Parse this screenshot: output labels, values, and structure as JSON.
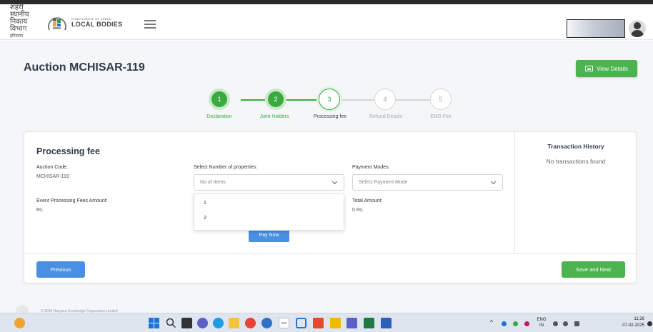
{
  "header": {
    "logo_hindi_main": "शहरी स्थानीय",
    "logo_hindi_sub": "निकाय विभाग",
    "logo_hindi_tiny": "हरियाणा",
    "logo_eng_top": "DIRECTORATE OF URBAN",
    "logo_eng_main": "LOCAL BODIES"
  },
  "page": {
    "title": "Auction MCHISAR-119",
    "view_details": "View Details"
  },
  "stepper": {
    "steps": [
      {
        "number": "1",
        "label": "Declaration",
        "state": "done"
      },
      {
        "number": "2",
        "label": "Joint Holders",
        "state": "done"
      },
      {
        "number": "3",
        "label": "Processing fee",
        "state": "active"
      },
      {
        "number": "4",
        "label": "Refund Details",
        "state": "todo"
      },
      {
        "number": "5",
        "label": "EMD Fee",
        "state": "todo"
      }
    ]
  },
  "form": {
    "section_title": "Processing fee",
    "auction_code_label": "Auction Code:",
    "auction_code_value": "MCHISAR-119",
    "properties_label": "Select Number of properties:",
    "properties_placeholder": "No of Items",
    "payment_label": "Payment Modes:",
    "payment_placeholder": "Select Payment Mode",
    "event_fee_label": "Event Processing Fees Amount:",
    "event_fee_value": "Rs.",
    "total_label": "Total Amount:",
    "total_value": "0 Rs.",
    "dropdown_options": [
      "1",
      "2"
    ],
    "pay_now": "Pay Now"
  },
  "transactions": {
    "title": "Transaction History",
    "empty": "No transactions found"
  },
  "nav": {
    "previous": "Previous",
    "save_next": "Save and Next"
  },
  "footer": {
    "copyright": "© 2025 Haryana Knowledge Corporation Limited"
  },
  "taskbar": {
    "lang_top": "ENG",
    "lang_bottom": "IN",
    "time": "11:26",
    "date": "07-02-2025",
    "pdf_label": "PDF",
    "colors": {
      "windows": "#1e73d6",
      "edge": "#1b9de2",
      "chrome": "#e94235",
      "excel": "#1f7a43",
      "word": "#2b5fb8"
    }
  },
  "colors": {
    "green": "#3aaa3f",
    "blue": "#4a90e2",
    "title": "#2f3b4a"
  }
}
